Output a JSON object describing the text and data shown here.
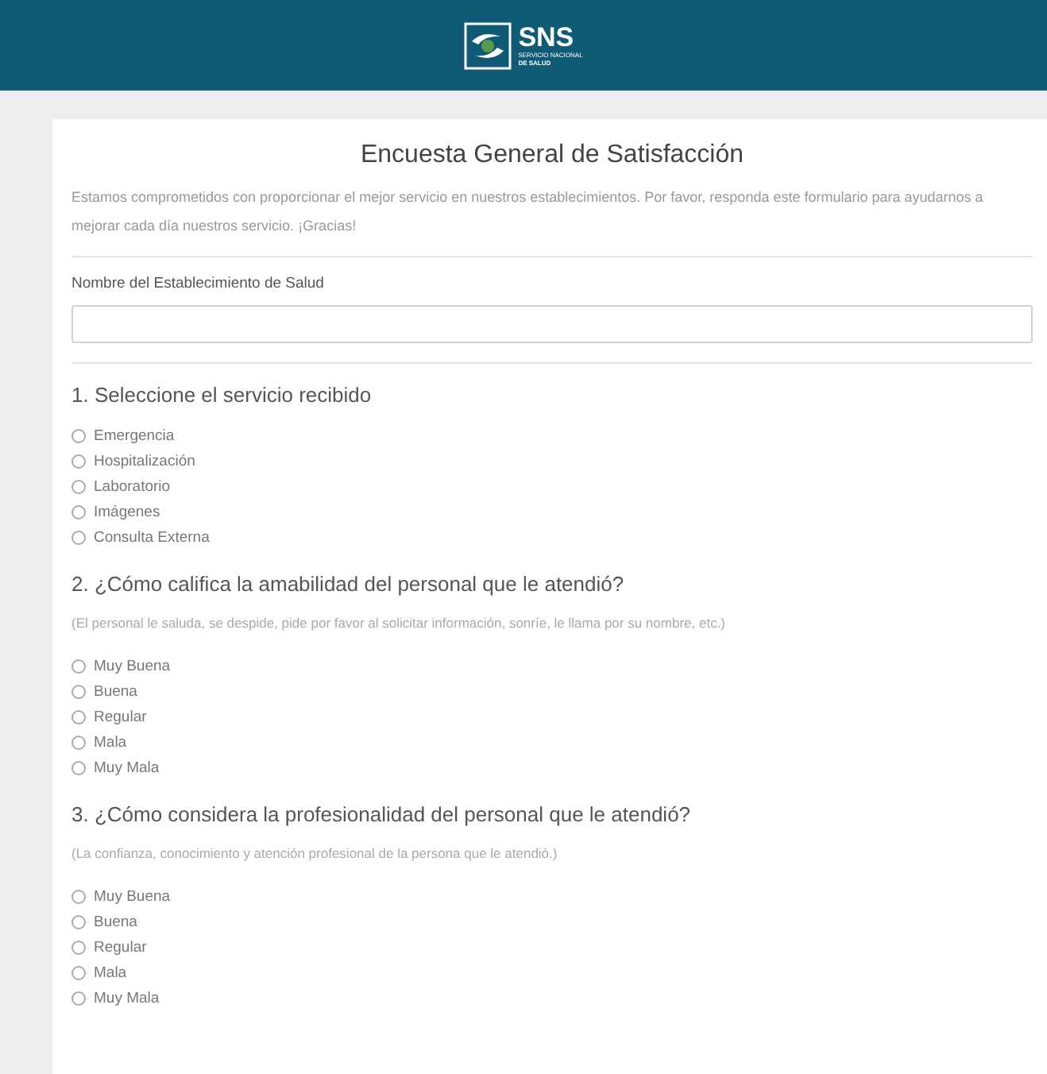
{
  "header": {
    "logo": {
      "name": "SNS",
      "subtitle_lines": [
        "SERVICIO NACIONAL",
        "DE SALUD"
      ]
    }
  },
  "form": {
    "title": "Encuesta General de Satisfacción",
    "intro": "Estamos comprometidos con proporcionar el mejor servicio en nuestros establecimientos. Por favor, responda este formulario para ayudarnos a mejorar cada día nuestros servicio. ¡Gracias!",
    "field": {
      "label": "Nombre del Establecimiento de Salud"
    },
    "questions": [
      {
        "title": "1. Seleccione el servicio recibido",
        "options": [
          {
            "label": "Emergencia",
            "selected": false
          },
          {
            "label": "Hospitalización",
            "selected": false
          },
          {
            "label": "Laboratorio",
            "selected": false
          },
          {
            "label": "Imágenes",
            "selected": false
          },
          {
            "label": "Consulta Externa",
            "selected": false
          }
        ]
      },
      {
        "title": "2. ¿Cómo califica la amabilidad del personal que le atendió?",
        "hint": "(El personal le saluda, se despide, pide por favor al solicitar información, sonríe, le llama por su nombre, etc.)",
        "options": [
          {
            "label": "Muy Buena",
            "selected": false
          },
          {
            "label": "Buena",
            "selected": false
          },
          {
            "label": "Regular",
            "selected": false
          },
          {
            "label": "Mala",
            "selected": false
          },
          {
            "label": "Muy Mala",
            "selected": false
          }
        ]
      },
      {
        "title": "3. ¿Cómo considera la profesionalidad del personal que le atendió?",
        "hint": "(La confianza, conocimiento y atención profesional de la persona que le atendió.)",
        "options": [
          {
            "label": "Muy Buena",
            "selected": false
          },
          {
            "label": "Buena",
            "selected": false
          },
          {
            "label": "Regular",
            "selected": false
          },
          {
            "label": "Mala",
            "selected": false
          },
          {
            "label": "Muy Mala",
            "selected": false
          }
        ]
      }
    ]
  }
}
